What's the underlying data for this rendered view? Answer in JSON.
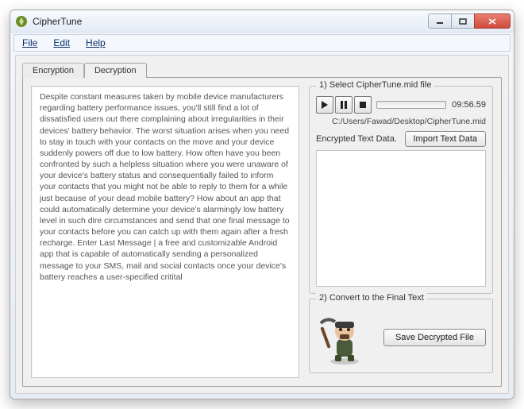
{
  "window": {
    "title": "CipherTune"
  },
  "menu": {
    "file": "File",
    "edit": "Edit",
    "help": "Help"
  },
  "tabs": {
    "encryption": "Encryption",
    "decryption": "Decryption"
  },
  "leftText": "Despite constant measures taken by mobile device manufacturers regarding battery performance issues, you'll still find a lot of dissatisfied users out there complaining about irregularities in their devices' battery behavior. The worst situation arises when you need to stay in touch with your contacts on the move and your device suddenly powers off due to low battery. How often have you been confronted by such a helpless situation where you were unaware of your device's battery status and consequentially failed to inform your contacts that you might not be able to reply to them for a while just because of your dead mobile battery? How about an app that could automatically determine your device's alarmingly low battery level in such dire circumstances and send that one final message to your contacts before you can catch up with them again after a fresh recharge. Enter Last Message | a free and customizable Android app that is capable of automatically sending a personalized message to your SMS, mail and social contacts once your device's battery reaches a user-specified critital",
  "right": {
    "select": {
      "legend": "1) Select CipherTune.mid file",
      "time": "09:56.59",
      "path": "C:/Users/Fawad/Desktop/CipherTune.mid",
      "encryptedLabel": "Encrypted Text Data.",
      "importBtn": "Import Text Data"
    },
    "convert": {
      "legend": "2) Convert to the Final Text",
      "saveBtn": "Save Decrypted File"
    }
  }
}
